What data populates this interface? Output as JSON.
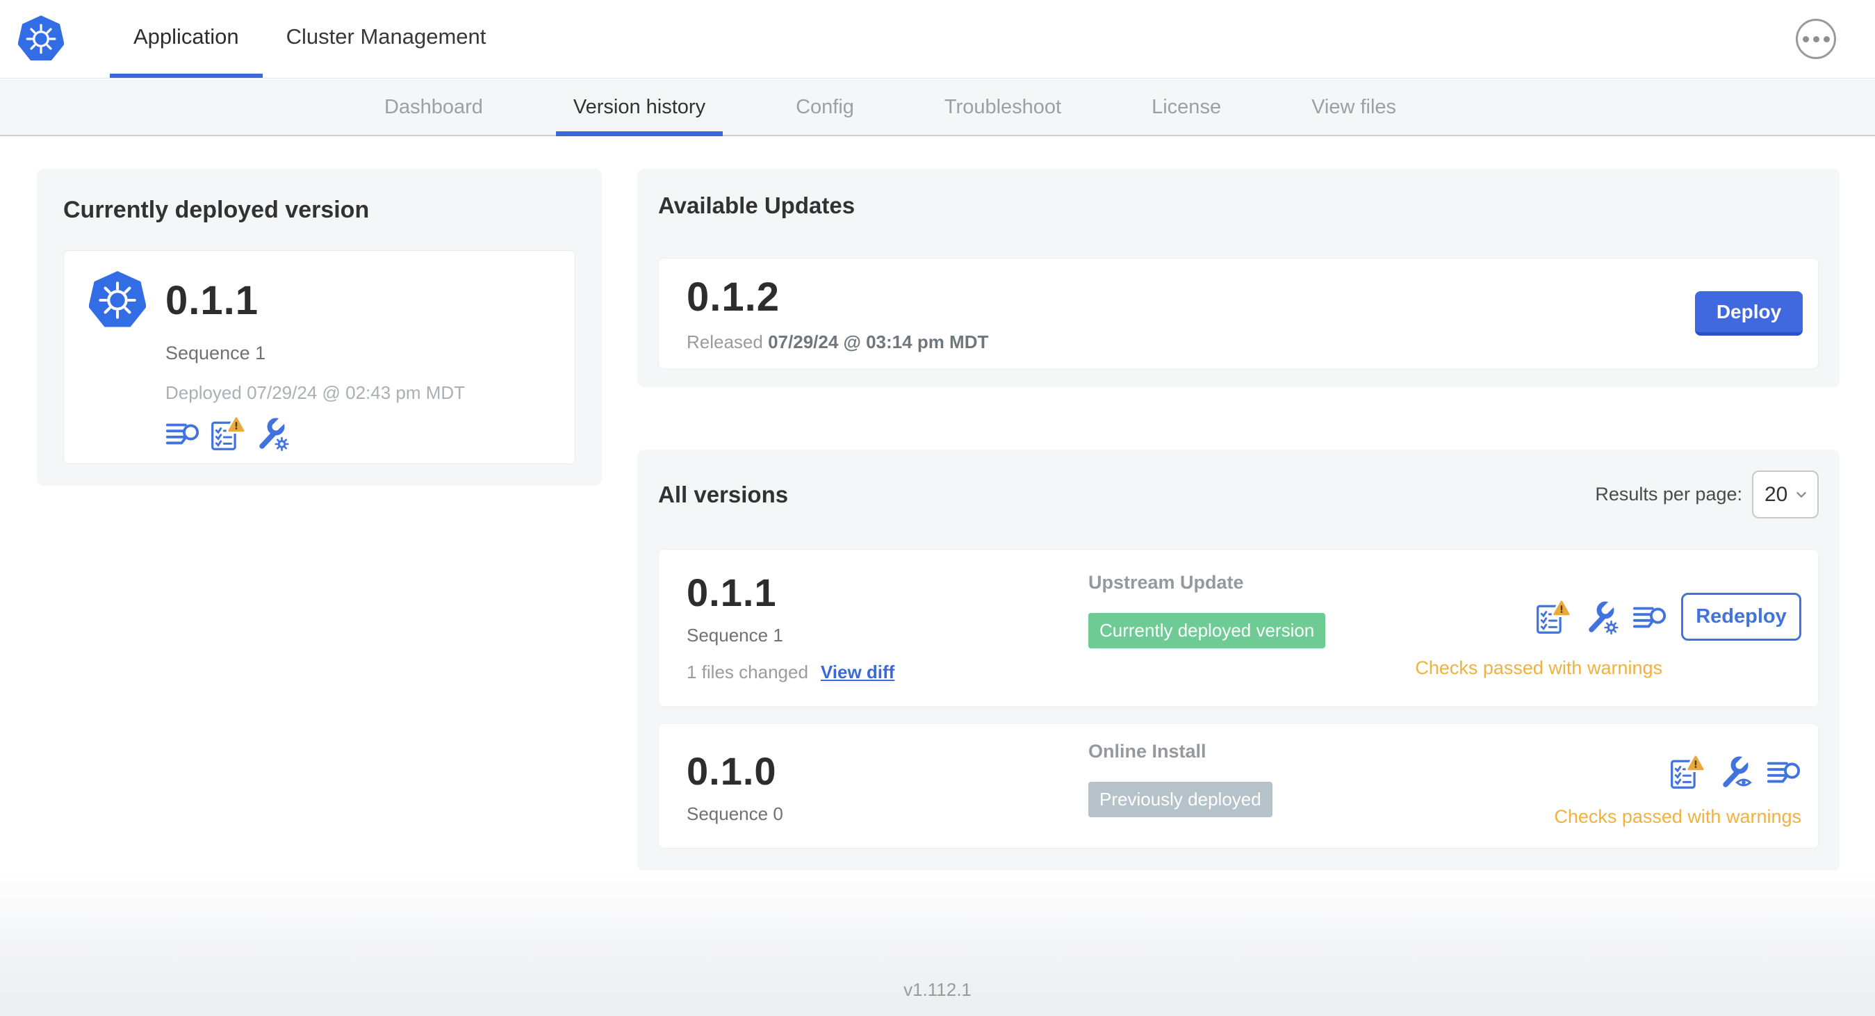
{
  "header": {
    "tabs": [
      {
        "label": "Application",
        "active": true
      },
      {
        "label": "Cluster Management",
        "active": false
      }
    ]
  },
  "nav": {
    "tabs": [
      {
        "label": "Dashboard",
        "active": false
      },
      {
        "label": "Version history",
        "active": true
      },
      {
        "label": "Config",
        "active": false
      },
      {
        "label": "Troubleshoot",
        "active": false
      },
      {
        "label": "License",
        "active": false
      },
      {
        "label": "View files",
        "active": false
      }
    ]
  },
  "current_version": {
    "title": "Currently deployed version",
    "version": "0.1.1",
    "sequence": "Sequence 1",
    "deployed": "Deployed 07/29/24 @ 02:43 pm MDT",
    "icons": [
      "logs-icon",
      "preflight-checks-warning-icon",
      "config-wrench-gear-icon"
    ]
  },
  "available_updates": {
    "title": "Available Updates",
    "version": "0.1.2",
    "released_label": "Released",
    "released_date": "07/29/24 @ 03:14 pm MDT",
    "deploy_label": "Deploy"
  },
  "all_versions": {
    "title": "All versions",
    "results_per_page_label": "Results per page:",
    "results_per_page_value": "20",
    "rows": [
      {
        "version": "0.1.1",
        "sequence": "Sequence 1",
        "files_changed": "1 files changed",
        "view_diff_label": "View diff",
        "source": "Upstream Update",
        "badge": "Currently deployed version",
        "badge_color": "#6ecb94",
        "status": "Checks passed with warnings",
        "action_label": "Redeploy",
        "icons": [
          "preflight-checks-warning-icon",
          "config-wrench-gear-icon",
          "logs-icon"
        ]
      },
      {
        "version": "0.1.0",
        "sequence": "Sequence 0",
        "source": "Online Install",
        "badge": "Previously deployed",
        "badge_color": "#b6c2c9",
        "status": "Checks passed with warnings",
        "icons": [
          "preflight-checks-warning-icon",
          "config-wrench-eye-icon",
          "logs-icon"
        ]
      }
    ]
  },
  "footer": {
    "version": "v1.112.1"
  },
  "colors": {
    "accent_blue": "#3a6ada",
    "kubernetes_blue": "#326de6",
    "button_blue": "#4169df",
    "success_green": "#6ecb94",
    "muted_badge_gray": "#b6c2c9",
    "warning_orange": "#f0b13e",
    "card_gray": "#f4f6f8"
  }
}
